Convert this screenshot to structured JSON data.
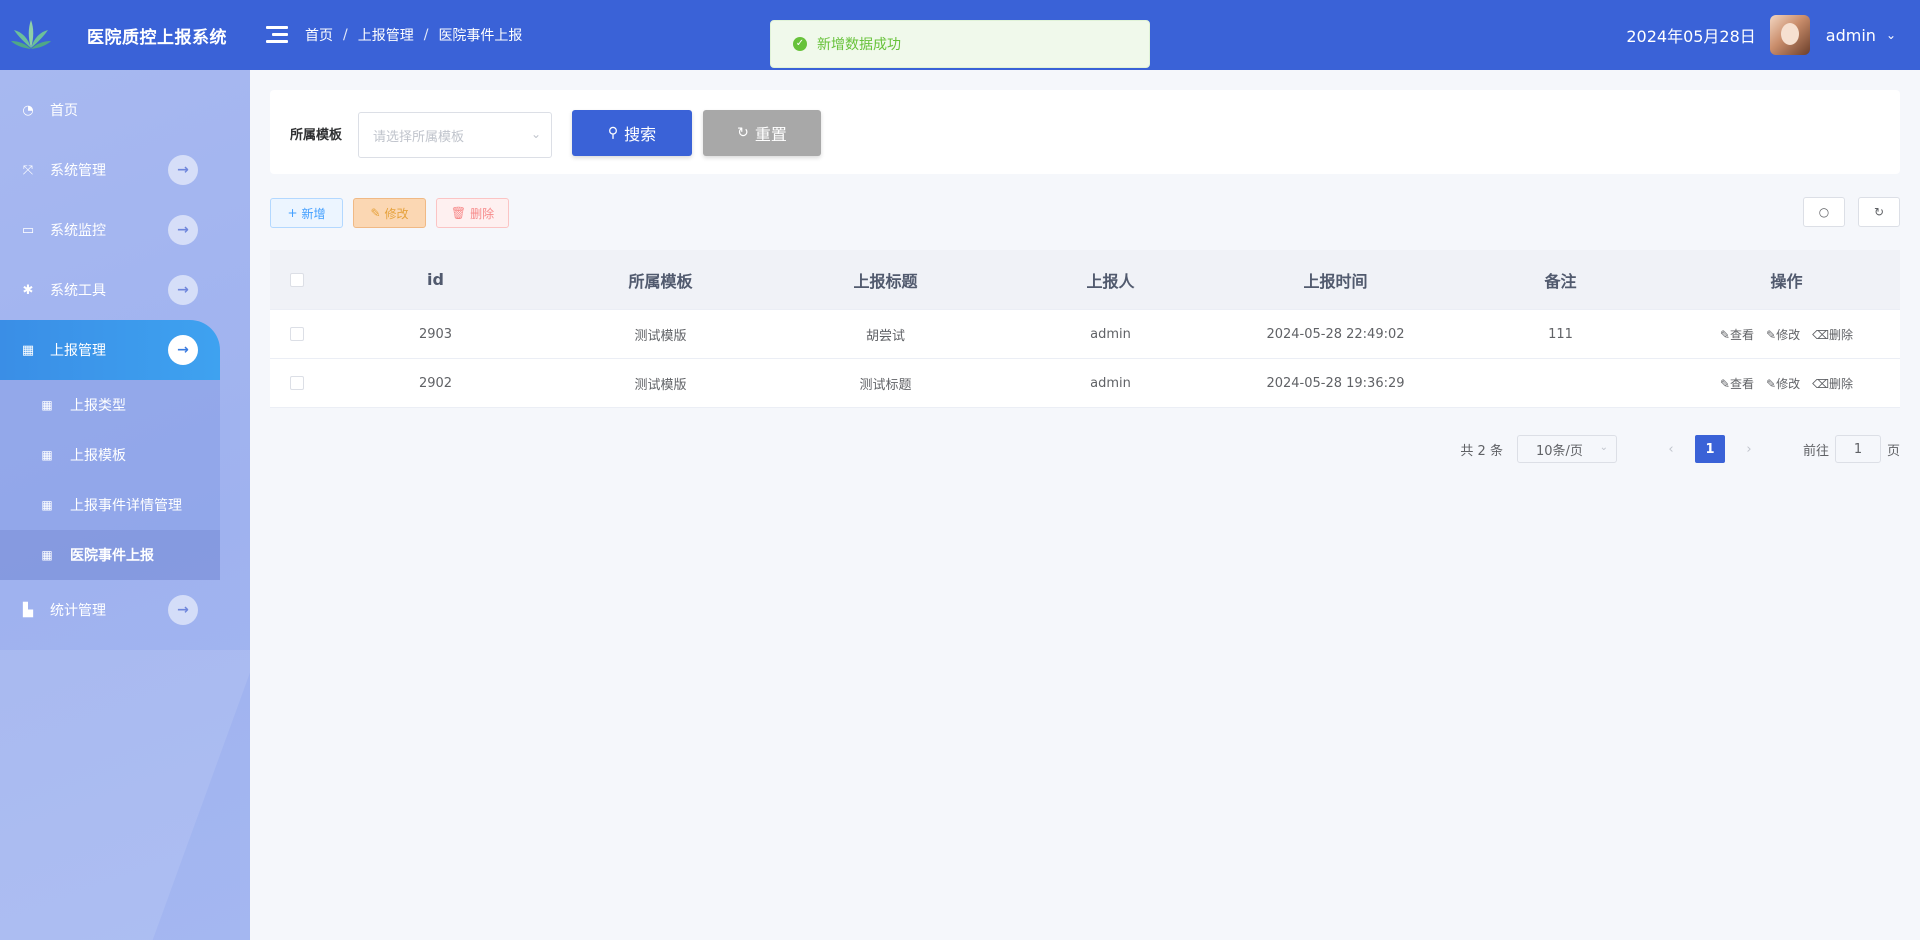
{
  "header": {
    "app_title": "医院质控上报系统",
    "breadcrumb": [
      "首页",
      "上报管理",
      "医院事件上报"
    ],
    "breadcrumb_sep": "/",
    "date": "2024年05月28日",
    "user": "admin",
    "bg_color": "#3a62d7"
  },
  "toast": {
    "message": "新增数据成功",
    "icon": "check-circle-icon",
    "color": "#67c23a"
  },
  "sidebar": {
    "items": [
      {
        "label": "首页",
        "icon": "dashboard-icon"
      },
      {
        "label": "系统管理",
        "icon": "system-icon"
      },
      {
        "label": "系统监控",
        "icon": "monitor-icon"
      },
      {
        "label": "系统工具",
        "icon": "bug-icon"
      },
      {
        "label": "上报管理",
        "icon": "table-icon"
      },
      {
        "label": "统计管理",
        "icon": "chart-icon"
      }
    ],
    "submenu": [
      {
        "label": "上报类型"
      },
      {
        "label": "上报模板"
      },
      {
        "label": "上报事件详情管理"
      },
      {
        "label": "医院事件上报"
      }
    ]
  },
  "search": {
    "label": "所属模板",
    "placeholder": "请选择所属模板",
    "search_button": "搜索",
    "reset_button": "重置"
  },
  "toolbar": {
    "add": "新增",
    "edit": "修改",
    "delete": "删除"
  },
  "table": {
    "headers": [
      "id",
      "所属模板",
      "上报标题",
      "上报人",
      "上报时间",
      "备注",
      "操作"
    ],
    "rows": [
      {
        "id": "2903",
        "template": "测试模版",
        "title": "胡尝试",
        "user": "admin",
        "time": "2024-05-28 22:49:02",
        "note": "111"
      },
      {
        "id": "2902",
        "template": "测试模版",
        "title": "测试标题",
        "user": "admin",
        "time": "2024-05-28 19:36:29",
        "note": ""
      }
    ],
    "ops": {
      "view": "查看",
      "edit": "修改",
      "delete": "删除"
    }
  },
  "pagination": {
    "total": "共 2 条",
    "page_size": "10条/页",
    "current": "1",
    "goto_prefix": "前往",
    "goto_value": "1",
    "goto_suffix": "页"
  }
}
